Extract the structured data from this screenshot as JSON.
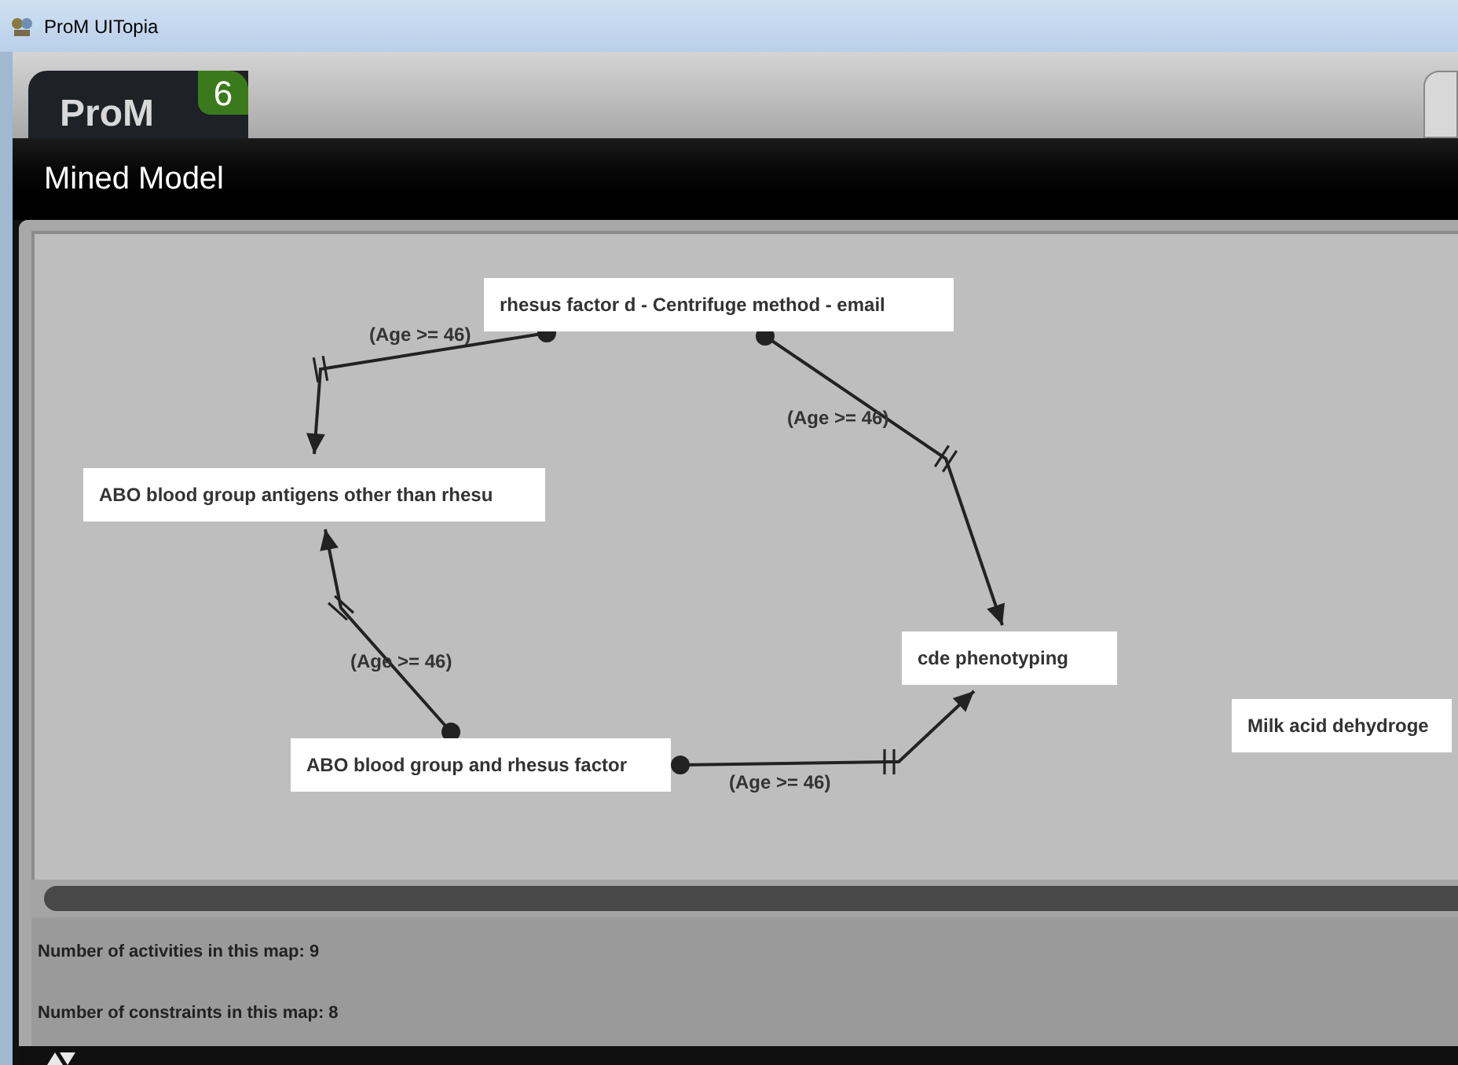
{
  "window": {
    "title": "ProM UITopia"
  },
  "logo": {
    "name": "ProM",
    "version": "6"
  },
  "view": {
    "title": "Mined Model"
  },
  "diagram": {
    "nodes": [
      {
        "label": "rhesus factor d - Centrifuge method - email"
      },
      {
        "label": "ABO blood group antigens other than rhesu"
      },
      {
        "label": "cde phenotyping"
      },
      {
        "label": "ABO blood group and rhesus factor"
      },
      {
        "label": "Milk acid dehydroge"
      }
    ],
    "edges": [
      {
        "label": "(Age >= 46)"
      },
      {
        "label": "(Age >= 46)"
      },
      {
        "label": "(Age >= 46)"
      },
      {
        "label": "(Age >= 46)"
      }
    ]
  },
  "info": [
    "Number of activities in this map: 9",
    "Number of constraints in this map: 8"
  ]
}
